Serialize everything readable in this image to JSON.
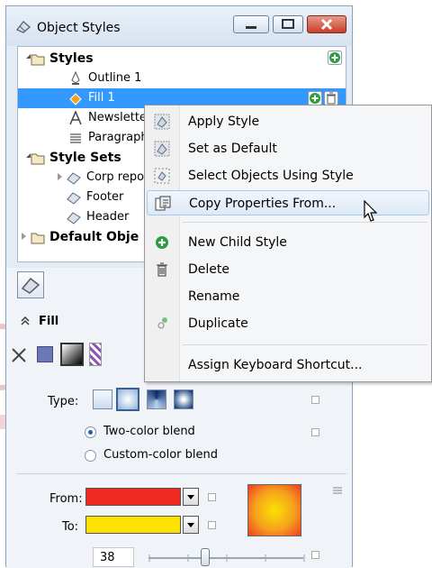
{
  "window": {
    "title": "Object Styles"
  },
  "tree": {
    "styles_label": "Styles",
    "outline_label": "Outline 1",
    "fill_label": "Fill 1",
    "newsletter_label": "Newslette",
    "paragraph_label": "Paragraph",
    "style_sets_label": "Style Sets",
    "corp_label": "Corp repo",
    "footer_label": "Footer",
    "header_label": "Header",
    "default_label": "Default Obje"
  },
  "fill_section": {
    "header": "Fill",
    "type_label": "Type:",
    "radio_two_color": "Two-color blend",
    "radio_custom_color": "Custom-color blend",
    "from_label": "From:",
    "to_label": "To:",
    "from_color": "#ee2a22",
    "to_color": "#fbe200",
    "midpoint_value": "38"
  },
  "context_menu": {
    "apply_style": "Apply Style",
    "set_default": "Set as Default",
    "select_objects": "Select Objects Using Style",
    "copy_properties": "Copy Properties From...",
    "new_child_style": "New Child Style",
    "delete": "Delete",
    "rename": "Rename",
    "duplicate": "Duplicate",
    "assign_shortcut": "Assign Keyboard Shortcut..."
  },
  "icons": [
    "object-styles-icon",
    "add-style-icon",
    "delete-icon",
    "outline-pen-icon",
    "fill-bucket-icon",
    "text-style-icon",
    "paragraph-icon",
    "folder-icon",
    "mouse-cursor-icon"
  ],
  "colors": {
    "selection": "#3399ff",
    "menu_highlight": "#dde9f7",
    "add_green": "#2a9d3c"
  }
}
